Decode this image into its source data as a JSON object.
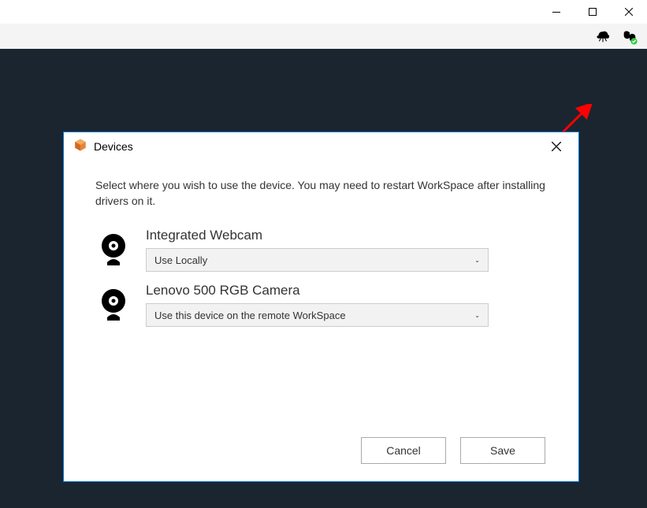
{
  "dialog": {
    "title": "Devices",
    "instruction": "Select where you wish to use the device. You may need to restart WorkSpace after installing drivers on it.",
    "devices": [
      {
        "name": "Integrated Webcam",
        "selection": "Use Locally"
      },
      {
        "name": "Lenovo 500 RGB Camera",
        "selection": "Use this device on the remote WorkSpace"
      }
    ],
    "buttons": {
      "cancel": "Cancel",
      "save": "Save"
    }
  }
}
